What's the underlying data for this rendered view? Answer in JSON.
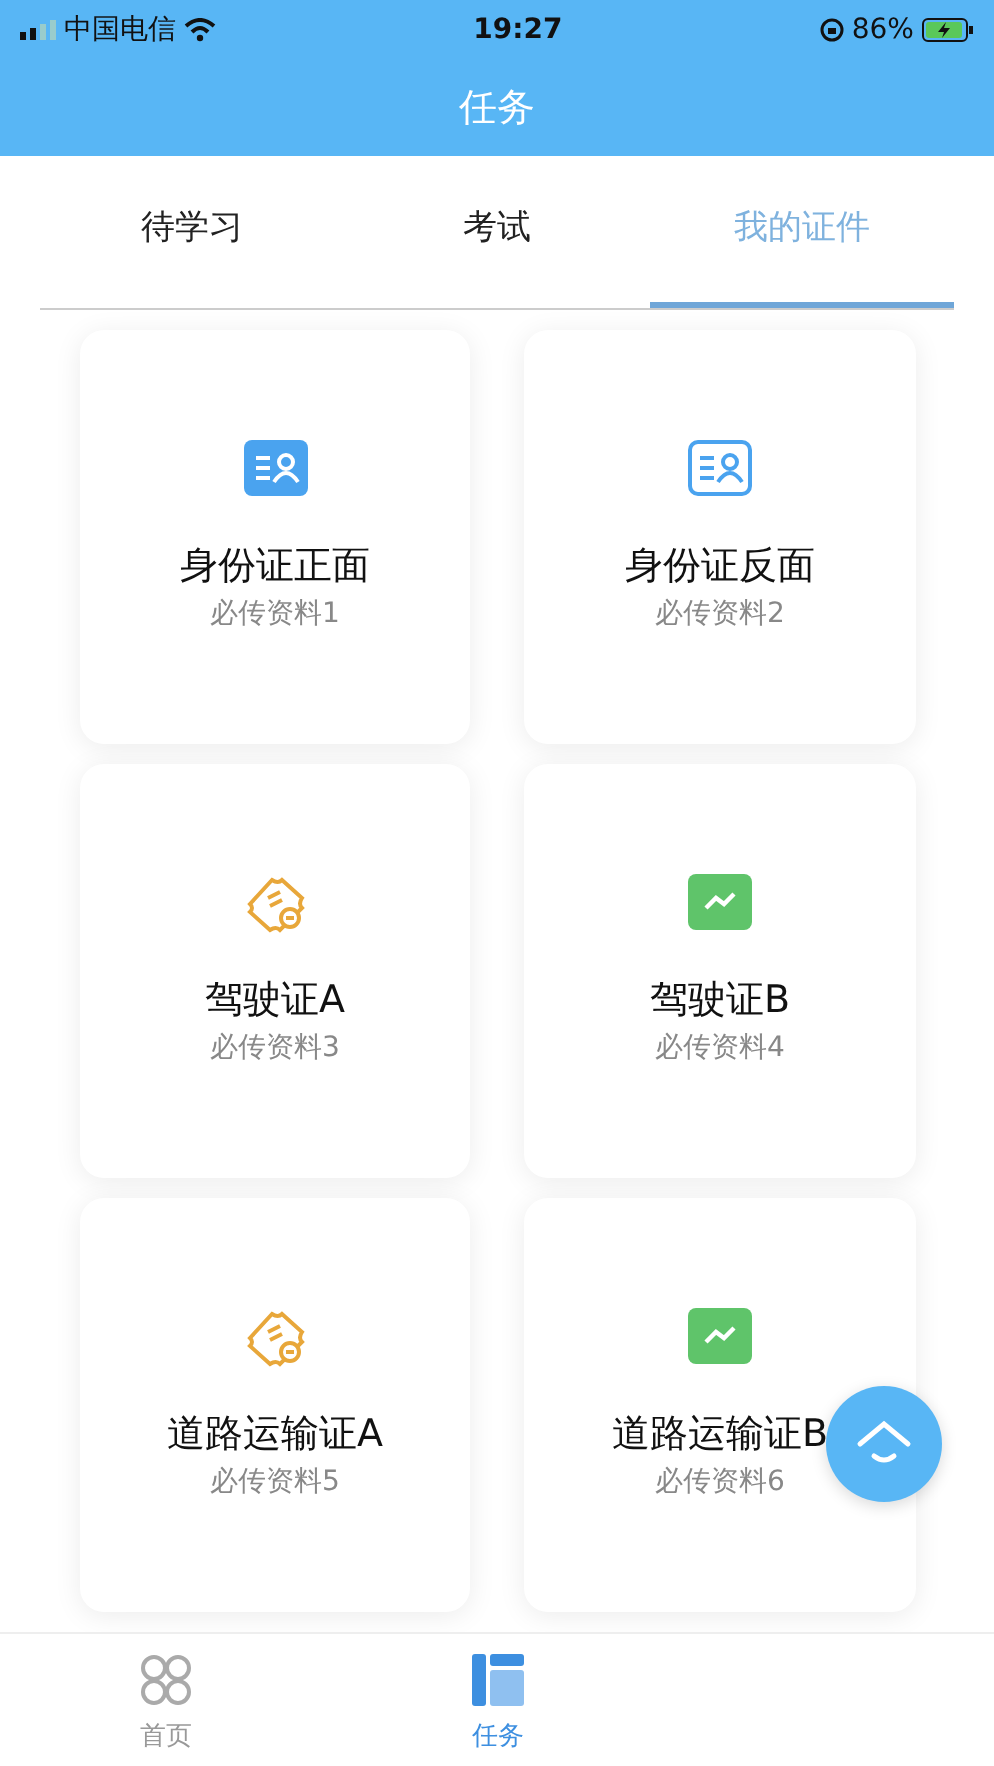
{
  "status_bar": {
    "carrier": "中国电信",
    "time": "19:27",
    "battery": "86%"
  },
  "header": {
    "title": "任务"
  },
  "tabs": [
    {
      "label": "待学习",
      "selected": false
    },
    {
      "label": "考试",
      "selected": false
    },
    {
      "label": "我的证件",
      "selected": true
    }
  ],
  "cards": [
    {
      "kind": "idsolid",
      "title": "身份证正面",
      "subtitle": "必传资料1"
    },
    {
      "kind": "idoutline",
      "title": "身份证反面",
      "subtitle": "必传资料2"
    },
    {
      "kind": "ticket",
      "title": "驾驶证A",
      "subtitle": "必传资料3"
    },
    {
      "kind": "chart",
      "title": "驾驶证B",
      "subtitle": "必传资料4"
    },
    {
      "kind": "ticket",
      "title": "道路运输证A",
      "subtitle": "必传资料5"
    },
    {
      "kind": "chart",
      "title": "道路运输证B",
      "subtitle": "必传资料6"
    }
  ],
  "bottom_nav": [
    {
      "label": "首页",
      "kind": "home",
      "selected": false
    },
    {
      "label": "任务",
      "kind": "task",
      "selected": true
    }
  ]
}
